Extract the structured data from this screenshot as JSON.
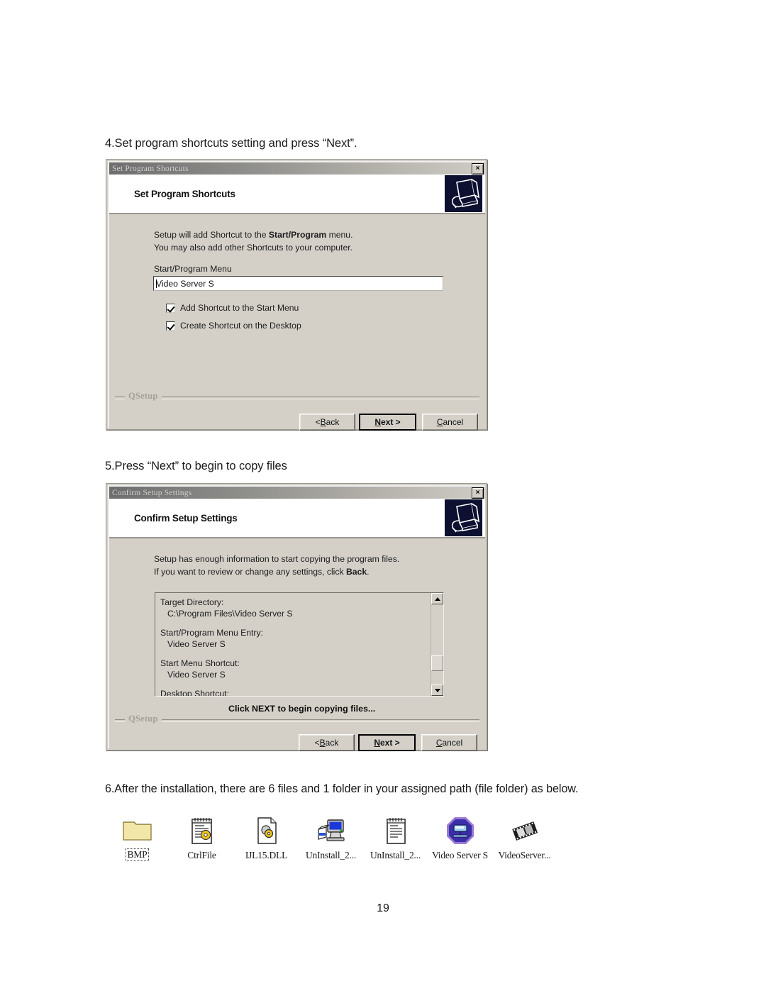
{
  "document": {
    "step4": "4.Set program shortcuts setting and  press “Next”.",
    "step5": "5.Press “Next” to begin to copy files",
    "step6": "6.After the installation, there are 6 files and 1 folder in your assigned path (file folder) as below.",
    "page_number": "19"
  },
  "dialog_shortcuts": {
    "titlebar": "Set Program Shortcuts",
    "close_label": "×",
    "header_title": "Set Program Shortcuts",
    "line1_pre": "Setup will add Shortcut to the ",
    "line1_bold": "Start/Program",
    "line1_post": " menu.",
    "line2": "You may also add other Shortcuts to your computer.",
    "field_label": "Start/Program Menu",
    "field_value": "Video Server S",
    "checkbox1": "Add Shortcut to the Start Menu",
    "checkbox2": "Create Shortcut on the Desktop",
    "group_label": "QSetup",
    "back_label": "< Back",
    "next_label": "Next >",
    "cancel_label": "Cancel"
  },
  "dialog_confirm": {
    "titlebar": "Confirm Setup Settings",
    "close_label": "×",
    "header_title": "Confirm Setup Settings",
    "line1": "Setup has enough information to start copying the program files.",
    "line2_pre": "If you want to review or change any settings, click ",
    "line2_bold": "Back",
    "line2_post": ".",
    "summary": [
      "Target Directory:",
      "C:\\Program Files\\Video Server S",
      "Start/Program Menu Entry:",
      "Video Server S",
      "Start Menu Shortcut:",
      "Video Server S",
      "Desktop Shortcut:"
    ],
    "note": "Click NEXT to begin copying files...",
    "group_label": "QSetup",
    "back_label": "< Back",
    "next_label": "Next >",
    "cancel_label": "Cancel"
  },
  "files": [
    {
      "label": "BMP",
      "icon": "folder-icon",
      "selected": true
    },
    {
      "label": "CtrlFile",
      "icon": "notepad-gear-icon",
      "selected": false
    },
    {
      "label": "IJL15.DLL",
      "icon": "dll-page-gear-icon",
      "selected": false
    },
    {
      "label": "UnInstall_2...",
      "icon": "uninstall-computer-icon",
      "selected": false
    },
    {
      "label": "UnInstall_2...",
      "icon": "notepad-icon",
      "selected": false
    },
    {
      "label": "Video Server S",
      "icon": "video-server-octagon-icon",
      "selected": false
    },
    {
      "label": "VideoServer...",
      "icon": "film-strip-icon",
      "selected": false
    }
  ]
}
